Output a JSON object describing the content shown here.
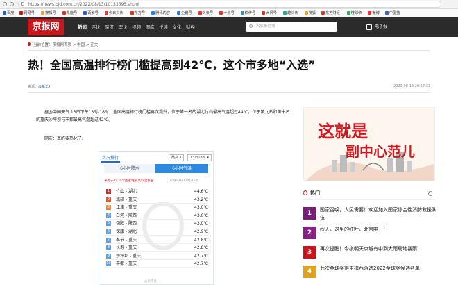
{
  "browser": {
    "url": "https://news.bjd.com.cn/2022/08/13/10133595.shtml",
    "bookmarks": [
      {
        "label": "百度",
        "color": "#2f5cd5"
      },
      {
        "label": "网易号",
        "color": "#c8161d"
      },
      {
        "label": "搜狐号",
        "color": "#f4a21a"
      },
      {
        "label": "凯迪号",
        "color": "#d32"
      },
      {
        "label": "百家号",
        "color": "#2f5cd5"
      },
      {
        "label": "今日头条",
        "color": "#e33"
      },
      {
        "label": "东方号",
        "color": "#d32"
      },
      {
        "label": "腾讯内容",
        "color": "#1e80ff"
      },
      {
        "label": "企鹅号",
        "color": "#1e80ff"
      },
      {
        "label": "头条号",
        "color": "#e33"
      },
      {
        "label": "一点号",
        "color": "#d32"
      },
      {
        "label": "快传号",
        "color": "#39a"
      },
      {
        "label": "大风号",
        "color": "#d32"
      },
      {
        "label": "趣头条",
        "color": "#2a8"
      },
      {
        "label": "搜狐",
        "color": "#f4a21a"
      },
      {
        "label": "东方财经",
        "color": "#d32"
      },
      {
        "label": "懂球帝",
        "color": "#3a6"
      },
      {
        "label": "微博",
        "color": "#e33"
      },
      {
        "label": "中国蓝",
        "color": "#2f5cd5"
      }
    ]
  },
  "site": {
    "logo": "京报网",
    "nav": [
      "新闻",
      "评论",
      "深度",
      "理论",
      "视频",
      "图库",
      "悦读",
      "文化",
      "财经"
    ],
    "search_placeholder": "大家都在搜",
    "ebook": "电子报"
  },
  "breadcrumb": "当前位置：京报网首页 > 中国 > 正文",
  "article": {
    "title": "热！全国高温排行榜门槛提高到42℃，这个市多地“入选”",
    "source": "来源：",
    "source_name": "@新华社",
    "date": "2022-08-13 20:57:33",
    "paragraphs": [
      "据@中国天气 13日下午13时-18时，全国高温排行榜门槛再次提升，位于第一名的湖北竹山最高气温超过44℃，位于第九名和第十名的重庆沙坪坝与丰都最高气温超过42℃。",
      "网友：真的要热化了。"
    ]
  },
  "weather": {
    "tab_title": "实况排行",
    "select_metric": "最高 ▾",
    "select_time": "13日18时 ▾",
    "tabs": [
      "6小时降水",
      "6小时气温"
    ],
    "note": "来源于2410个国家站最高气温排名",
    "note_time": "08月13日13时-18时",
    "rows": [
      {
        "rank": "1",
        "city": "竹山 - 湖北",
        "temp": "44.6℃"
      },
      {
        "rank": "2",
        "city": "北碚 - 重庆",
        "temp": "43.2℃"
      },
      {
        "rank": "3",
        "city": "江津 - 重庆",
        "temp": "43.0℃"
      },
      {
        "rank": "4",
        "city": "白河 - 陕西",
        "temp": "43.0℃"
      },
      {
        "rank": "5",
        "city": "旬阳 - 陕西",
        "temp": "43.0℃"
      },
      {
        "rank": "6",
        "city": "保康 - 湖北",
        "temp": "42.9℃"
      },
      {
        "rank": "7",
        "city": "奉节 - 重庆",
        "temp": "42.8℃"
      },
      {
        "rank": "8",
        "city": "长寿 - 重庆",
        "temp": "42.8℃"
      },
      {
        "rank": "9",
        "city": "沙坪坝 - 重庆",
        "temp": "42.7℃"
      },
      {
        "rank": "10",
        "city": "丰都 - 重庆",
        "temp": "42.7℃"
      }
    ],
    "rank_colors": [
      "#d9262c",
      "#e6552a",
      "#f08a2e",
      "#5aa3e6"
    ],
    "caption": "@新华社"
  },
  "banner": {
    "line1": "这就是",
    "line2": "副中心范儿"
  },
  "hot": {
    "heading": "热门",
    "items": [
      {
        "rank": "1",
        "text": "国家召唤，人民需要！欢迎加入国家综合性消防救援队伍",
        "color": "#7b1e7a"
      },
      {
        "rank": "2",
        "text": "秋天，这里的红叶，北京唯一！",
        "color": "#8a1f86"
      },
      {
        "rank": "3",
        "text": "再次提醒！今夜明天京城有中到大雨局地暴雨",
        "color": "#c8161d"
      },
      {
        "rank": "4",
        "text": "七次金球奖得主梅西落选2022金球奖候选名单",
        "color": "#e0a321"
      }
    ]
  }
}
